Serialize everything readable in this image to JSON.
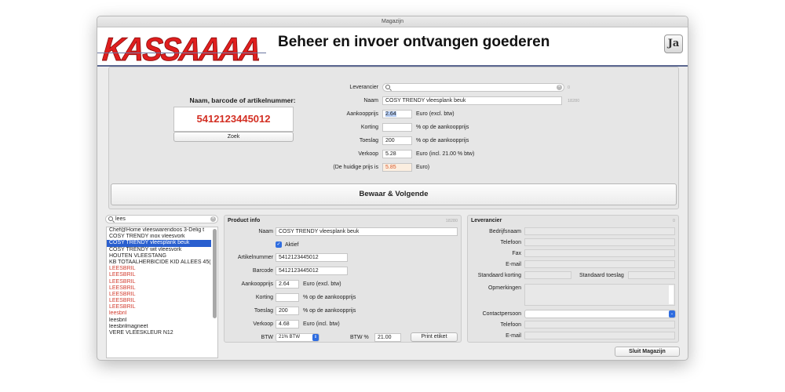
{
  "window": {
    "title": "Magazijn"
  },
  "header": {
    "logo_text": "KASSAAAAA",
    "title": "Beheer en invoer ontvangen goederen",
    "app_icon": "Ja"
  },
  "search": {
    "title": "Naam, barcode of artikelnummer:",
    "barcode": "5412123445012",
    "button": "Zoek"
  },
  "entry": {
    "leverancier_label": "Leverancier",
    "leverancier_value": "",
    "leverancier_count": "0",
    "naam_label": "Naam",
    "naam_value": "COSY  TRENDY vleesplank beuk",
    "naam_count": "18280",
    "aankoop_label": "Aankoopprijs",
    "aankoop_value": "2.64",
    "aankoop_unit": "Euro (excl. btw)",
    "korting_label": "Korting",
    "korting_value": "",
    "korting_unit": "% op de aankoopprijs",
    "toeslag_label": "Toeslag",
    "toeslag_value": "200",
    "toeslag_unit": "% op de aankoopprijs",
    "verkoop_label": "Verkoop",
    "verkoop_value": "5.28",
    "verkoop_unit": "Euro (incl. 21.00 % btw)",
    "huidige_label": "(De huidige prijs is",
    "huidige_value": "5.85",
    "huidige_unit": "Euro)"
  },
  "bewaar_button": "Bewaar & Volgende",
  "list": {
    "search_value": "lees",
    "items": [
      {
        "text": "Chef@Home vleeswarendoos 3-Delig t",
        "color": "normal"
      },
      {
        "text": "COSY  TRENDY inox vleesvork",
        "color": "normal"
      },
      {
        "text": "COSY  TRENDY vleesplank beuk",
        "color": "selected"
      },
      {
        "text": "COSY  TRENDY wit vleesvork",
        "color": "normal"
      },
      {
        "text": "HOUTEN VLEESTANG",
        "color": "normal"
      },
      {
        "text": "KB TOTAALHERBICIDE KID ALLEES 45(",
        "color": "normal"
      },
      {
        "text": "LEESBRIL",
        "color": "red"
      },
      {
        "text": "LEESBRIL",
        "color": "red"
      },
      {
        "text": "LEESBRIL",
        "color": "red"
      },
      {
        "text": "LEESBRIL",
        "color": "red"
      },
      {
        "text": "LEESBRIL",
        "color": "red"
      },
      {
        "text": "LEESBRIL",
        "color": "red"
      },
      {
        "text": "LEESBRIL",
        "color": "red"
      },
      {
        "text": "leesbril",
        "color": "red"
      },
      {
        "text": "leesbril",
        "color": "normal"
      },
      {
        "text": "leesbrilmagneet",
        "color": "normal"
      },
      {
        "text": "VERE VLEESKLEUR N12",
        "color": "normal"
      }
    ]
  },
  "product": {
    "title": "Product info",
    "count": "18280",
    "naam_label": "Naam",
    "naam_value": "COSY  TRENDY vleesplank beuk",
    "aktief_label": "Aktief",
    "artikel_label": "Artikelnummer",
    "artikel_value": "5412123445012",
    "barcode_label": "Barcode",
    "barcode_value": "5412123445012",
    "aankoop_label": "Aankoopprijs",
    "aankoop_value": "2.64",
    "aankoop_unit": "Euro (excl. btw)",
    "korting_label": "Korting",
    "korting_value": "",
    "korting_unit": "% op de aankoopprijs",
    "toeslag_label": "Toeslag",
    "toeslag_value": "200",
    "toeslag_unit": "% op de aankoopprijs",
    "verkoop_label": "Verkoop",
    "verkoop_value": "4.68",
    "verkoop_unit": "Euro (incl. btw)",
    "btw_label": "BTW",
    "btw_select": "21% BTW",
    "btw_pct_label": "BTW %",
    "btw_pct_value": "21.00",
    "print_button": "Print etiket"
  },
  "supplier": {
    "title": "Leverancier",
    "count": "0",
    "bedrijfsnaam": "Bedrijfsnaam",
    "telefoon": "Telefoon",
    "fax": "Fax",
    "email": "E-mail",
    "std_korting": "Standaard korting",
    "std_toeslag": "Standaard toeslag",
    "opmerkingen": "Opmerkingen",
    "contactpersoon": "Contactpersoon",
    "telefoon2": "Telefoon",
    "email2": "E-mail"
  },
  "sluit_button": "Sluit Magazijn",
  "colors": {
    "accent": "#2a5fcf",
    "price_red": "#d32f23",
    "logo_red": "#e01e1e"
  }
}
